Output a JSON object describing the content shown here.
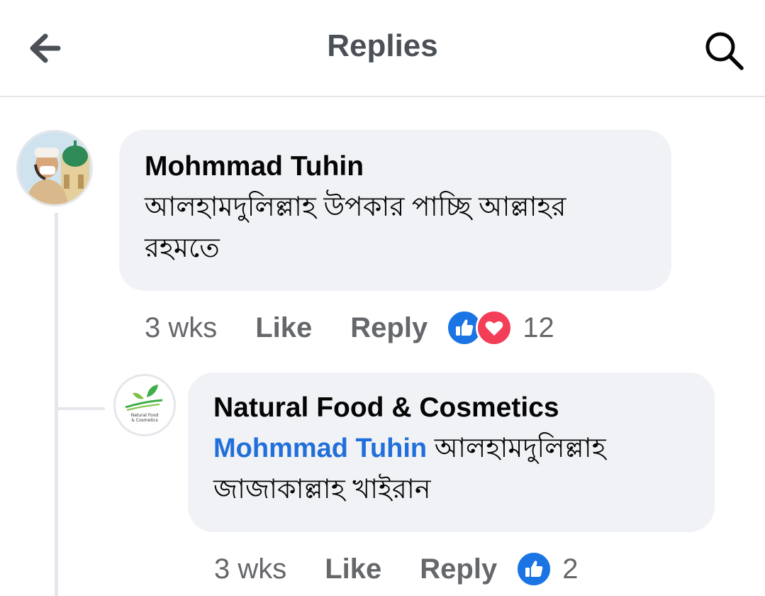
{
  "header": {
    "title": "Replies",
    "back_icon": "arrow-left-icon",
    "search_icon": "search-icon"
  },
  "comments": [
    {
      "author": "Mohmmad Tuhin",
      "text": "আলহামদুলিল্লাহ উপকার পাচ্ছি আল্লাহর রহমতে",
      "time": "3 wks",
      "like_label": "Like",
      "reply_label": "Reply",
      "reactions": [
        "like-icon",
        "love-icon"
      ],
      "reaction_count": "12"
    },
    {
      "author": "Natural Food & Cosmetics",
      "mention": "Mohmmad Tuhin",
      "text": "আলহামদুলিল্লাহ জাজাকাল্লাহ খাইরান",
      "time": "3 wks",
      "like_label": "Like",
      "reply_label": "Reply",
      "reactions": [
        "like-icon"
      ],
      "reaction_count": "2",
      "avatar_logo_text": [
        "Natural Food",
        "& Cosmetics"
      ]
    }
  ],
  "colors": {
    "bubble": "#f0f2f5",
    "mention": "#216fdb",
    "like": "#1b74e4",
    "love": "#f33e58",
    "muted": "#65676b"
  }
}
